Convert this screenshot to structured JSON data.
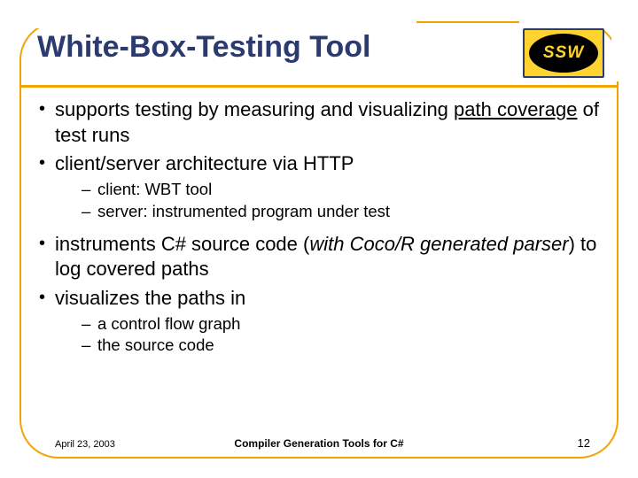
{
  "title": "White-Box-Testing Tool",
  "logo_text": "SSW",
  "bullets": {
    "b1_pre": "supports testing by measuring and visualizing ",
    "b1_link": "path coverage",
    "b1_post": " of test runs",
    "b2": "client/server architecture via HTTP",
    "b2_subs": {
      "s1": "client: WBT tool",
      "s2": "server: instrumented program under test"
    },
    "b3_pre": "instruments C# source code (",
    "b3_ital": "with Coco/R generated parser",
    "b3_post": ") to log covered paths",
    "b4": "visualizes the paths in",
    "b4_subs": {
      "s1": "a control flow graph",
      "s2": "the source code"
    }
  },
  "footer": {
    "date": "April 23, 2003",
    "title": "Compiler Generation Tools for C#",
    "page": "12"
  }
}
